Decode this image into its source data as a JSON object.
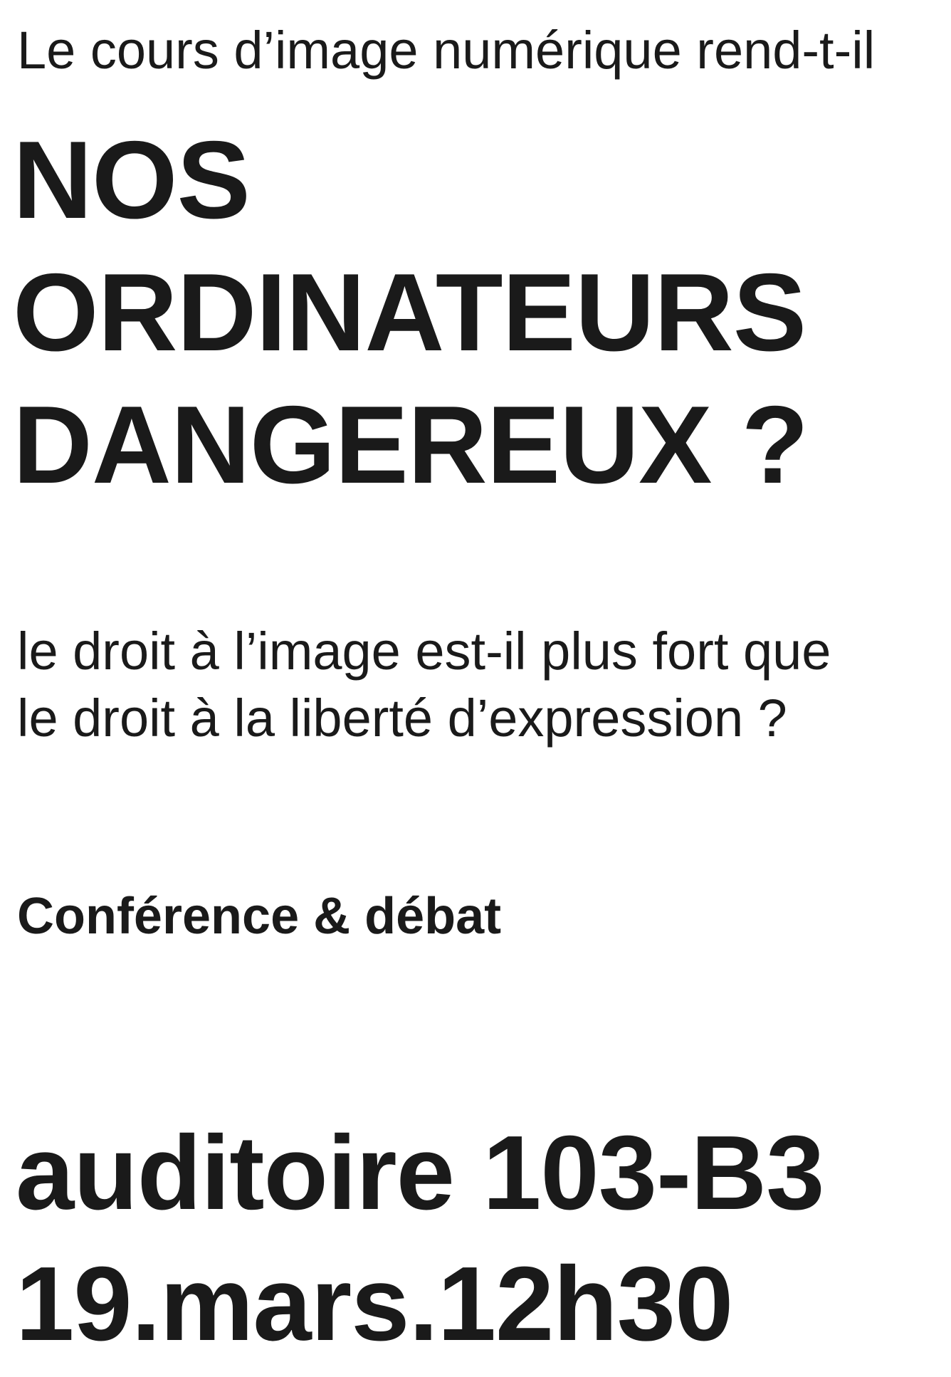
{
  "intro": "Le cours d’image numérique rend-t-il",
  "headline": [
    "NOS",
    "ORDINATEURS",
    "DANGEREUX ?"
  ],
  "question": [
    "le droit à l’image est-il plus fort que",
    "le droit à la liberté d’expression ?"
  ],
  "event_type": "Conférence & débat",
  "location": "auditoire 103-B3",
  "datetime": "19.mars.12h30"
}
